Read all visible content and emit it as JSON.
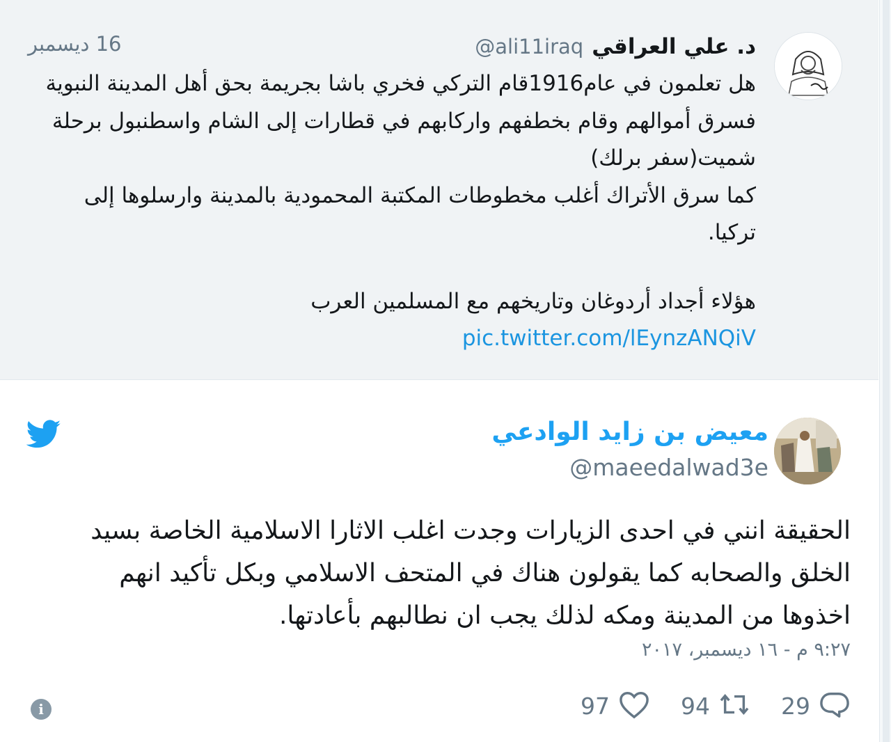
{
  "quoted_tweet": {
    "name": "د. علي العراقي",
    "handle": "@ali11iraq",
    "date": "16 ديسمبر",
    "lines": [
      "هل تعلمون في عام1916قام التركي فخري باشا بجريمة بحق أهل المدينة النبوية",
      "فسرق أموالهم وقام بخطفهم واركابهم في قطارات إلى الشام واسطنبول برحلة",
      "شميت(سفر برلك)",
      "كما سرق الأتراك أغلب مخطوطات المكتبة المحمودية بالمدينة وارسلوها إلى",
      "تركيا."
    ],
    "closing": "هؤلاء أجداد أردوغان وتاريخهم مع المسلمين العرب",
    "link": "pic.twitter.com/lEynzANQiV"
  },
  "tweet": {
    "name": "معيض بن زايد الوادعي",
    "handle": "@maeedalwad3e",
    "lines": [
      "الحقيقة انني في احدى الزيارات وجدت اغلب الاثارا الاسلامية الخاصة بسيد",
      "الخلق والصحابه كما يقولون هناك في المتحف الاسلامي وبكل تأكيد انهم",
      "اخذوها من المدينة ومكه لذلك يجب ان نطالبهم بأعادتها."
    ],
    "timestamp": "٩:٢٧ م - ١٦ ديسمبر، ٢٠١٧"
  },
  "actions": {
    "replies": "29",
    "retweets": "94",
    "likes": "97"
  },
  "colors": {
    "accent": "#1da1f2",
    "link": "#1b95e0",
    "muted": "#657786",
    "quoted_bg": "#f0f3f5"
  },
  "icons": [
    "twitter-bird-icon",
    "reply-icon",
    "retweet-icon",
    "like-icon",
    "info-icon"
  ]
}
